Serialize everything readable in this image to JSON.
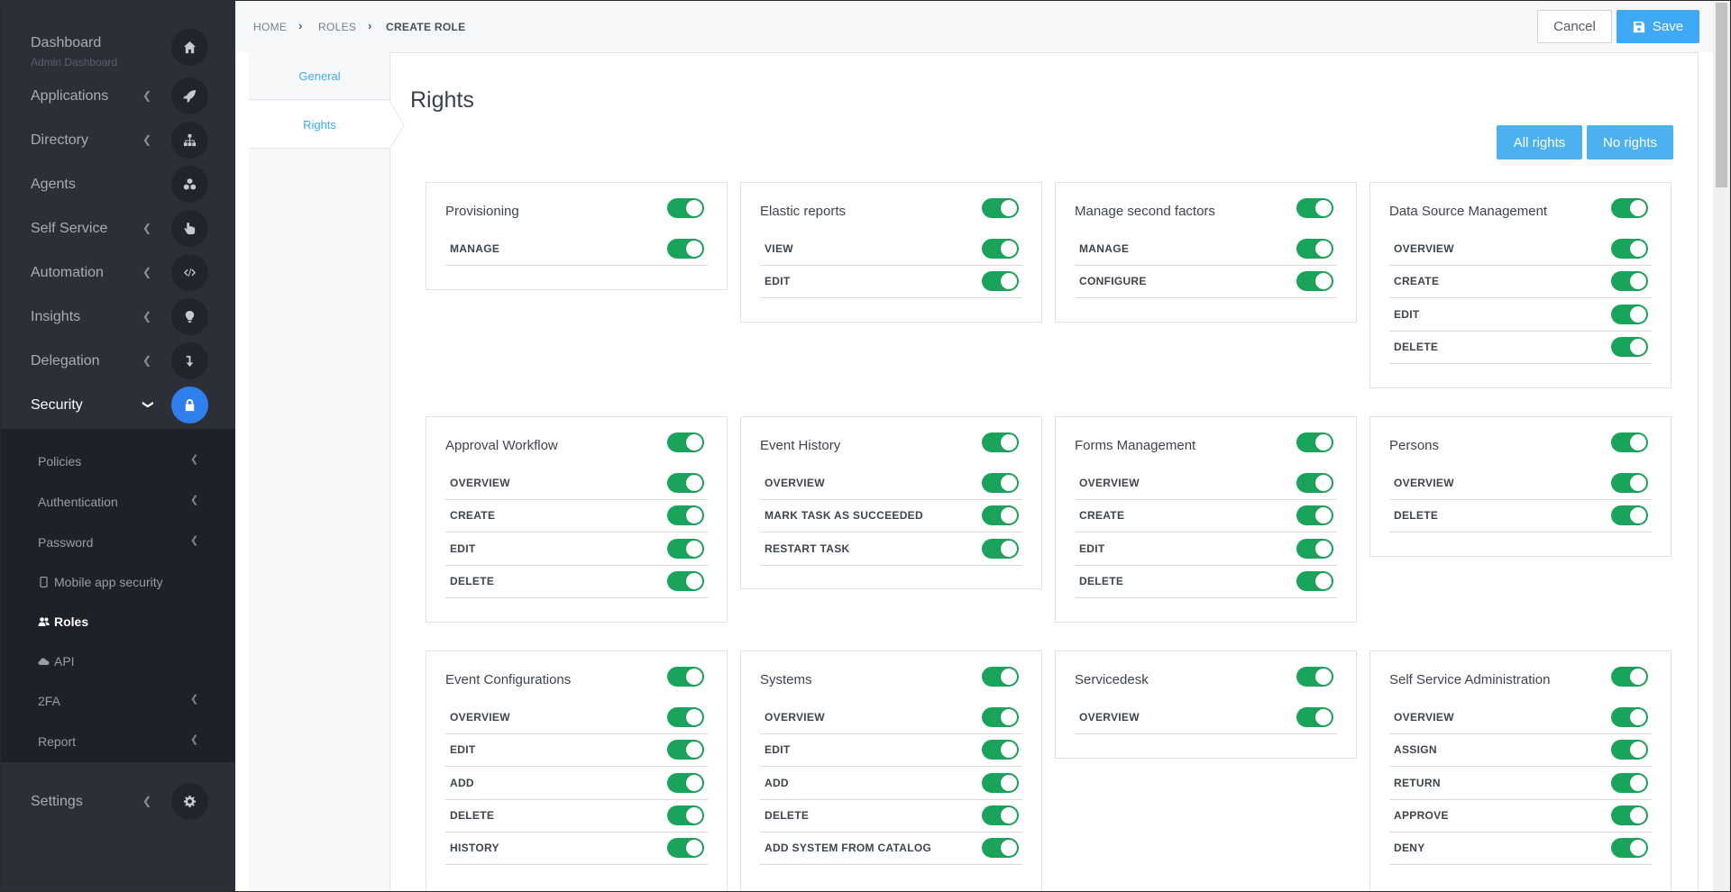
{
  "sidebar": {
    "dashboard": {
      "label": "Dashboard",
      "sub": "Admin Dashboard"
    },
    "items": [
      {
        "label": "Applications"
      },
      {
        "label": "Directory"
      },
      {
        "label": "Agents"
      },
      {
        "label": "Self Service"
      },
      {
        "label": "Automation"
      },
      {
        "label": "Insights"
      },
      {
        "label": "Delegation"
      },
      {
        "label": "Security"
      }
    ],
    "submenu": [
      {
        "label": "Policies"
      },
      {
        "label": "Authentication"
      },
      {
        "label": "Password"
      },
      {
        "label": "Mobile app security"
      },
      {
        "label": "Roles"
      },
      {
        "label": "API"
      },
      {
        "label": "2FA"
      },
      {
        "label": "Report"
      }
    ],
    "settings": {
      "label": "Settings"
    }
  },
  "breadcrumb": {
    "home": "HOME",
    "roles": "ROLES",
    "current": "CREATE ROLE"
  },
  "actions": {
    "cancel": "Cancel",
    "save": "Save"
  },
  "tabs": [
    {
      "label": "General"
    },
    {
      "label": "Rights"
    }
  ],
  "page": {
    "title": "Rights",
    "all_rights": "All rights",
    "no_rights": "No rights"
  },
  "cards": [
    {
      "title": "Provisioning",
      "rights": [
        "MANAGE"
      ]
    },
    {
      "title": "Elastic reports",
      "rights": [
        "VIEW",
        "EDIT"
      ]
    },
    {
      "title": "Manage second factors",
      "rights": [
        "MANAGE",
        "CONFIGURE"
      ]
    },
    {
      "title": "Data Source Management",
      "rights": [
        "OVERVIEW",
        "CREATE",
        "EDIT",
        "DELETE"
      ]
    },
    {
      "title": "Approval Workflow",
      "rights": [
        "OVERVIEW",
        "CREATE",
        "EDIT",
        "DELETE"
      ]
    },
    {
      "title": "Event History",
      "rights": [
        "OVERVIEW",
        "MARK TASK AS SUCCEEDED",
        "RESTART TASK"
      ]
    },
    {
      "title": "Forms Management",
      "rights": [
        "OVERVIEW",
        "CREATE",
        "EDIT",
        "DELETE"
      ]
    },
    {
      "title": "Persons",
      "rights": [
        "OVERVIEW",
        "DELETE"
      ]
    },
    {
      "title": "Event Configurations",
      "rights": [
        "OVERVIEW",
        "EDIT",
        "ADD",
        "DELETE",
        "HISTORY"
      ]
    },
    {
      "title": "Systems",
      "rights": [
        "OVERVIEW",
        "EDIT",
        "ADD",
        "DELETE",
        "ADD SYSTEM FROM CATALOG"
      ]
    },
    {
      "title": "Servicedesk",
      "rights": [
        "OVERVIEW"
      ]
    },
    {
      "title": "Self Service Administration",
      "rights": [
        "OVERVIEW",
        "ASSIGN",
        "RETURN",
        "APPROVE",
        "DENY"
      ]
    }
  ],
  "colors": {
    "toggle_on": "#1aa35a",
    "accent": "#3fa9f5",
    "sidebar": "#2c2f38",
    "active_icon": "#2f80ed"
  }
}
